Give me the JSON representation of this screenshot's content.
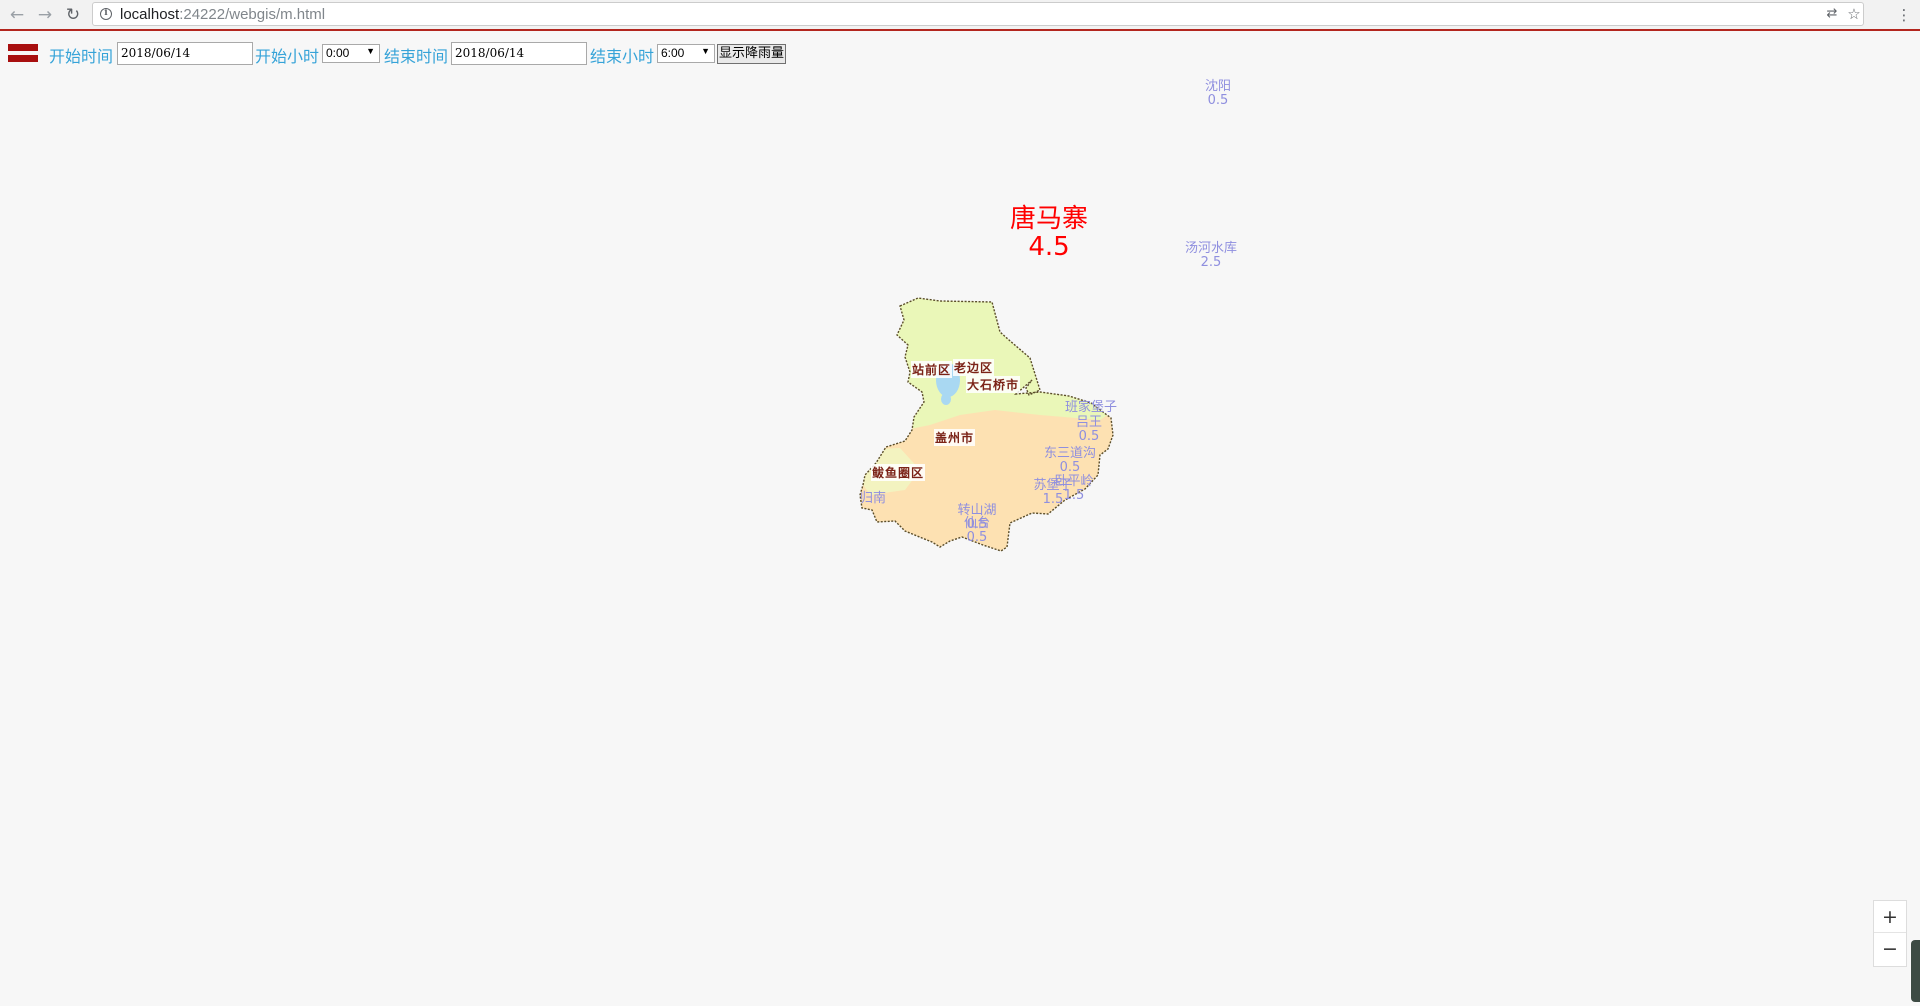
{
  "browser": {
    "url_host": "localhost",
    "url_rest": ":24222/webgis/m.html"
  },
  "toolbar": {
    "start_date_label": "开始时间",
    "start_date_value": "2018/06/14",
    "start_hour_label": "开始小时",
    "start_hour_value": "0:00",
    "end_date_label": "结束时间",
    "end_date_value": "2018/06/14",
    "end_hour_label": "结束小时",
    "end_hour_value": "6:00",
    "show_button": "显示降雨量"
  },
  "map": {
    "colors": {
      "north_region": "#eaf7b8",
      "south_region": "#fde1b2",
      "lake": "#a9d8f2",
      "border": "#5a4d2a",
      "station_text": "#8f8fdf",
      "highlight_station": "#ff0000"
    },
    "districts": [
      {
        "name": "站前区"
      },
      {
        "name": "老边区"
      },
      {
        "name": "大石桥市"
      },
      {
        "name": "盖州市"
      },
      {
        "name": "鲅鱼圈区"
      }
    ],
    "stations": [
      {
        "name": "沈阳",
        "value": "0.5"
      },
      {
        "name": "唐马寨",
        "value": "4.5"
      },
      {
        "name": "汤河水库",
        "value": "2.5"
      },
      {
        "name": "班家堡子",
        "value": "0.5"
      },
      {
        "name": "吕王",
        "value": "0.5"
      },
      {
        "name": "东三道沟",
        "value": "0.5"
      },
      {
        "name": "苏堡子",
        "value": "1.5"
      },
      {
        "name": "卧平岭",
        "value": "1.5"
      },
      {
        "name": "转山湖",
        "value": "0.5"
      },
      {
        "name": "仙台",
        "value": "0.5"
      },
      {
        "name": "归南",
        "value": ""
      }
    ]
  },
  "zoom": {
    "in_label": "+",
    "out_label": "−"
  }
}
